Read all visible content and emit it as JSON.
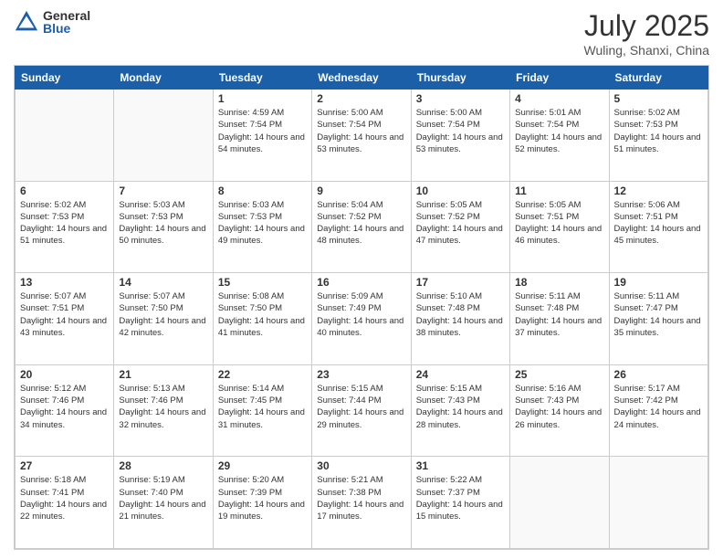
{
  "header": {
    "logo_general": "General",
    "logo_blue": "Blue",
    "month_title": "July 2025",
    "location": "Wuling, Shanxi, China"
  },
  "days": [
    "Sunday",
    "Monday",
    "Tuesday",
    "Wednesday",
    "Thursday",
    "Friday",
    "Saturday"
  ],
  "weeks": [
    [
      {
        "date": "",
        "empty": true
      },
      {
        "date": "",
        "empty": true
      },
      {
        "date": "1",
        "sunrise": "Sunrise: 4:59 AM",
        "sunset": "Sunset: 7:54 PM",
        "daylight": "Daylight: 14 hours and 54 minutes."
      },
      {
        "date": "2",
        "sunrise": "Sunrise: 5:00 AM",
        "sunset": "Sunset: 7:54 PM",
        "daylight": "Daylight: 14 hours and 53 minutes."
      },
      {
        "date": "3",
        "sunrise": "Sunrise: 5:00 AM",
        "sunset": "Sunset: 7:54 PM",
        "daylight": "Daylight: 14 hours and 53 minutes."
      },
      {
        "date": "4",
        "sunrise": "Sunrise: 5:01 AM",
        "sunset": "Sunset: 7:54 PM",
        "daylight": "Daylight: 14 hours and 52 minutes."
      },
      {
        "date": "5",
        "sunrise": "Sunrise: 5:02 AM",
        "sunset": "Sunset: 7:53 PM",
        "daylight": "Daylight: 14 hours and 51 minutes."
      }
    ],
    [
      {
        "date": "6",
        "sunrise": "Sunrise: 5:02 AM",
        "sunset": "Sunset: 7:53 PM",
        "daylight": "Daylight: 14 hours and 51 minutes."
      },
      {
        "date": "7",
        "sunrise": "Sunrise: 5:03 AM",
        "sunset": "Sunset: 7:53 PM",
        "daylight": "Daylight: 14 hours and 50 minutes."
      },
      {
        "date": "8",
        "sunrise": "Sunrise: 5:03 AM",
        "sunset": "Sunset: 7:53 PM",
        "daylight": "Daylight: 14 hours and 49 minutes."
      },
      {
        "date": "9",
        "sunrise": "Sunrise: 5:04 AM",
        "sunset": "Sunset: 7:52 PM",
        "daylight": "Daylight: 14 hours and 48 minutes."
      },
      {
        "date": "10",
        "sunrise": "Sunrise: 5:05 AM",
        "sunset": "Sunset: 7:52 PM",
        "daylight": "Daylight: 14 hours and 47 minutes."
      },
      {
        "date": "11",
        "sunrise": "Sunrise: 5:05 AM",
        "sunset": "Sunset: 7:51 PM",
        "daylight": "Daylight: 14 hours and 46 minutes."
      },
      {
        "date": "12",
        "sunrise": "Sunrise: 5:06 AM",
        "sunset": "Sunset: 7:51 PM",
        "daylight": "Daylight: 14 hours and 45 minutes."
      }
    ],
    [
      {
        "date": "13",
        "sunrise": "Sunrise: 5:07 AM",
        "sunset": "Sunset: 7:51 PM",
        "daylight": "Daylight: 14 hours and 43 minutes."
      },
      {
        "date": "14",
        "sunrise": "Sunrise: 5:07 AM",
        "sunset": "Sunset: 7:50 PM",
        "daylight": "Daylight: 14 hours and 42 minutes."
      },
      {
        "date": "15",
        "sunrise": "Sunrise: 5:08 AM",
        "sunset": "Sunset: 7:50 PM",
        "daylight": "Daylight: 14 hours and 41 minutes."
      },
      {
        "date": "16",
        "sunrise": "Sunrise: 5:09 AM",
        "sunset": "Sunset: 7:49 PM",
        "daylight": "Daylight: 14 hours and 40 minutes."
      },
      {
        "date": "17",
        "sunrise": "Sunrise: 5:10 AM",
        "sunset": "Sunset: 7:48 PM",
        "daylight": "Daylight: 14 hours and 38 minutes."
      },
      {
        "date": "18",
        "sunrise": "Sunrise: 5:11 AM",
        "sunset": "Sunset: 7:48 PM",
        "daylight": "Daylight: 14 hours and 37 minutes."
      },
      {
        "date": "19",
        "sunrise": "Sunrise: 5:11 AM",
        "sunset": "Sunset: 7:47 PM",
        "daylight": "Daylight: 14 hours and 35 minutes."
      }
    ],
    [
      {
        "date": "20",
        "sunrise": "Sunrise: 5:12 AM",
        "sunset": "Sunset: 7:46 PM",
        "daylight": "Daylight: 14 hours and 34 minutes."
      },
      {
        "date": "21",
        "sunrise": "Sunrise: 5:13 AM",
        "sunset": "Sunset: 7:46 PM",
        "daylight": "Daylight: 14 hours and 32 minutes."
      },
      {
        "date": "22",
        "sunrise": "Sunrise: 5:14 AM",
        "sunset": "Sunset: 7:45 PM",
        "daylight": "Daylight: 14 hours and 31 minutes."
      },
      {
        "date": "23",
        "sunrise": "Sunrise: 5:15 AM",
        "sunset": "Sunset: 7:44 PM",
        "daylight": "Daylight: 14 hours and 29 minutes."
      },
      {
        "date": "24",
        "sunrise": "Sunrise: 5:15 AM",
        "sunset": "Sunset: 7:43 PM",
        "daylight": "Daylight: 14 hours and 28 minutes."
      },
      {
        "date": "25",
        "sunrise": "Sunrise: 5:16 AM",
        "sunset": "Sunset: 7:43 PM",
        "daylight": "Daylight: 14 hours and 26 minutes."
      },
      {
        "date": "26",
        "sunrise": "Sunrise: 5:17 AM",
        "sunset": "Sunset: 7:42 PM",
        "daylight": "Daylight: 14 hours and 24 minutes."
      }
    ],
    [
      {
        "date": "27",
        "sunrise": "Sunrise: 5:18 AM",
        "sunset": "Sunset: 7:41 PM",
        "daylight": "Daylight: 14 hours and 22 minutes."
      },
      {
        "date": "28",
        "sunrise": "Sunrise: 5:19 AM",
        "sunset": "Sunset: 7:40 PM",
        "daylight": "Daylight: 14 hours and 21 minutes."
      },
      {
        "date": "29",
        "sunrise": "Sunrise: 5:20 AM",
        "sunset": "Sunset: 7:39 PM",
        "daylight": "Daylight: 14 hours and 19 minutes."
      },
      {
        "date": "30",
        "sunrise": "Sunrise: 5:21 AM",
        "sunset": "Sunset: 7:38 PM",
        "daylight": "Daylight: 14 hours and 17 minutes."
      },
      {
        "date": "31",
        "sunrise": "Sunrise: 5:22 AM",
        "sunset": "Sunset: 7:37 PM",
        "daylight": "Daylight: 14 hours and 15 minutes."
      },
      {
        "date": "",
        "empty": true
      },
      {
        "date": "",
        "empty": true
      }
    ]
  ]
}
